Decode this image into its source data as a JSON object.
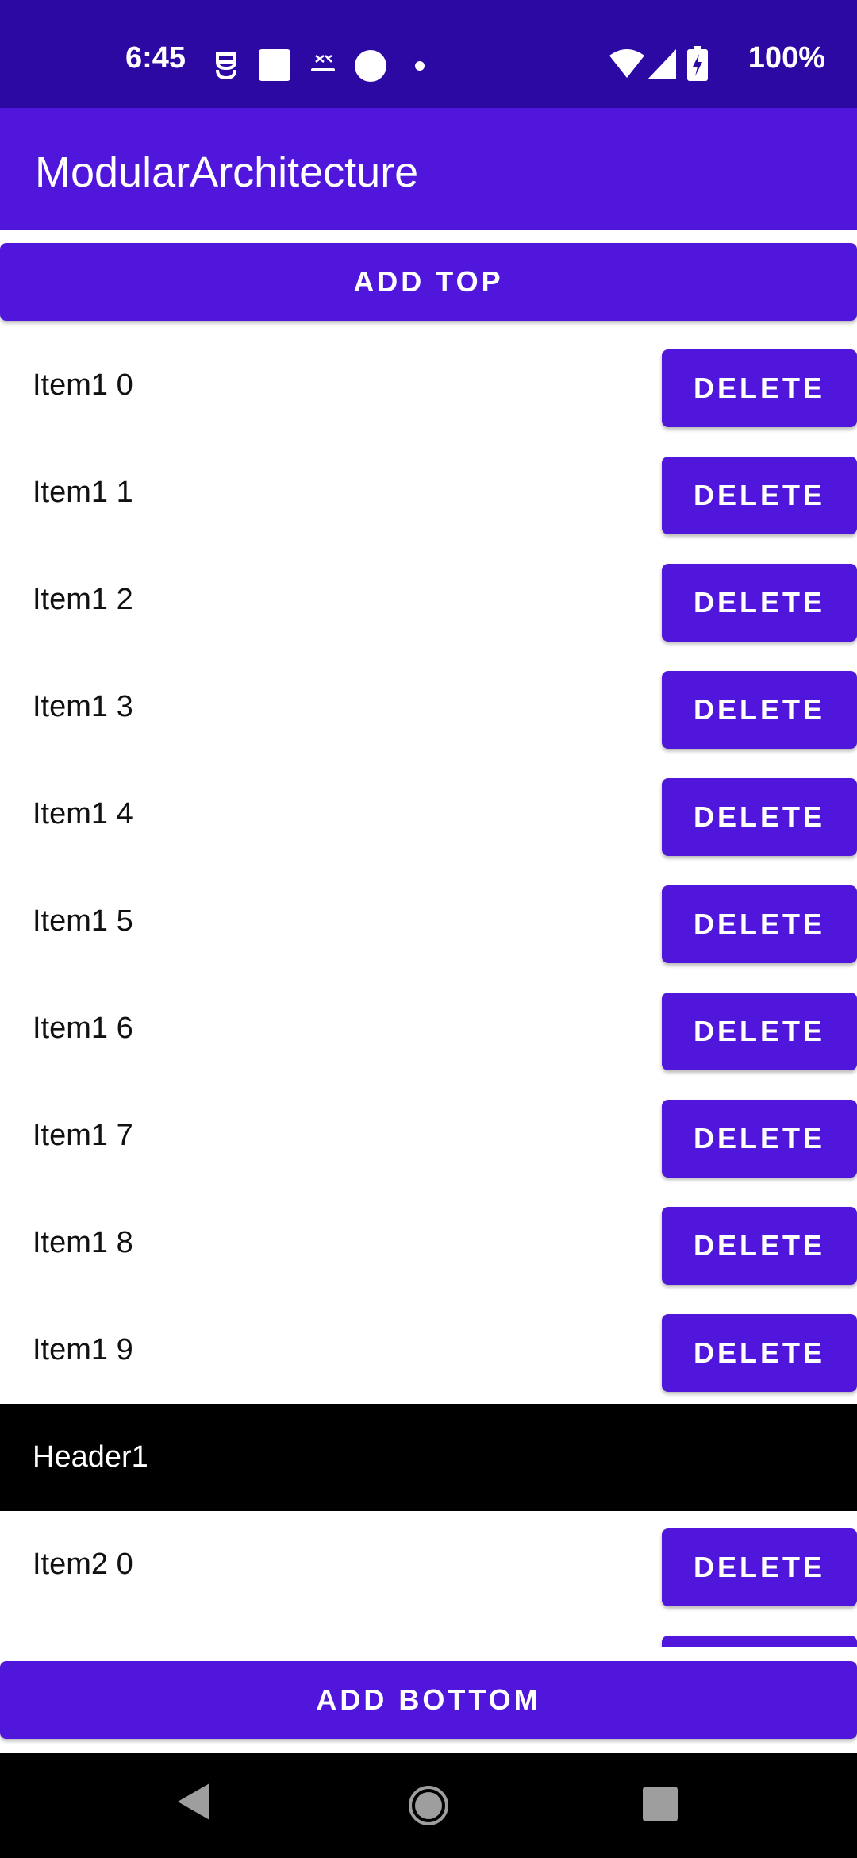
{
  "status_bar": {
    "time": "6:45",
    "battery": "100%",
    "icons": [
      "notification-app-icon",
      "square-app-icon",
      "exness-icon",
      "circle-app-icon",
      "dot-icon",
      "wifi-icon",
      "signal-icon",
      "battery-charging-icon"
    ]
  },
  "app_bar": {
    "title": "ModularArchitecture"
  },
  "actions": {
    "add_top": "ADD TOP",
    "add_bottom": "ADD BOTTOM"
  },
  "list": {
    "delete_label": "DELETE",
    "items": [
      {
        "type": "item",
        "label": "Item1 0"
      },
      {
        "type": "item",
        "label": "Item1 1"
      },
      {
        "type": "item",
        "label": "Item1 2"
      },
      {
        "type": "item",
        "label": "Item1 3"
      },
      {
        "type": "item",
        "label": "Item1 4"
      },
      {
        "type": "item",
        "label": "Item1 5"
      },
      {
        "type": "item",
        "label": "Item1 6"
      },
      {
        "type": "item",
        "label": "Item1 7"
      },
      {
        "type": "item",
        "label": "Item1 8"
      },
      {
        "type": "item",
        "label": "Item1 9"
      },
      {
        "type": "header",
        "label": "Header1"
      },
      {
        "type": "item",
        "label": "Item2 0"
      },
      {
        "type": "item",
        "label": ""
      }
    ]
  },
  "nav_bar": {
    "icons": [
      "back-icon",
      "home-icon",
      "recents-icon"
    ]
  },
  "colors": {
    "status_bar": "#2d09a3",
    "primary": "#5016dc",
    "header_bg": "#000000",
    "nav_bar": "#000000"
  }
}
